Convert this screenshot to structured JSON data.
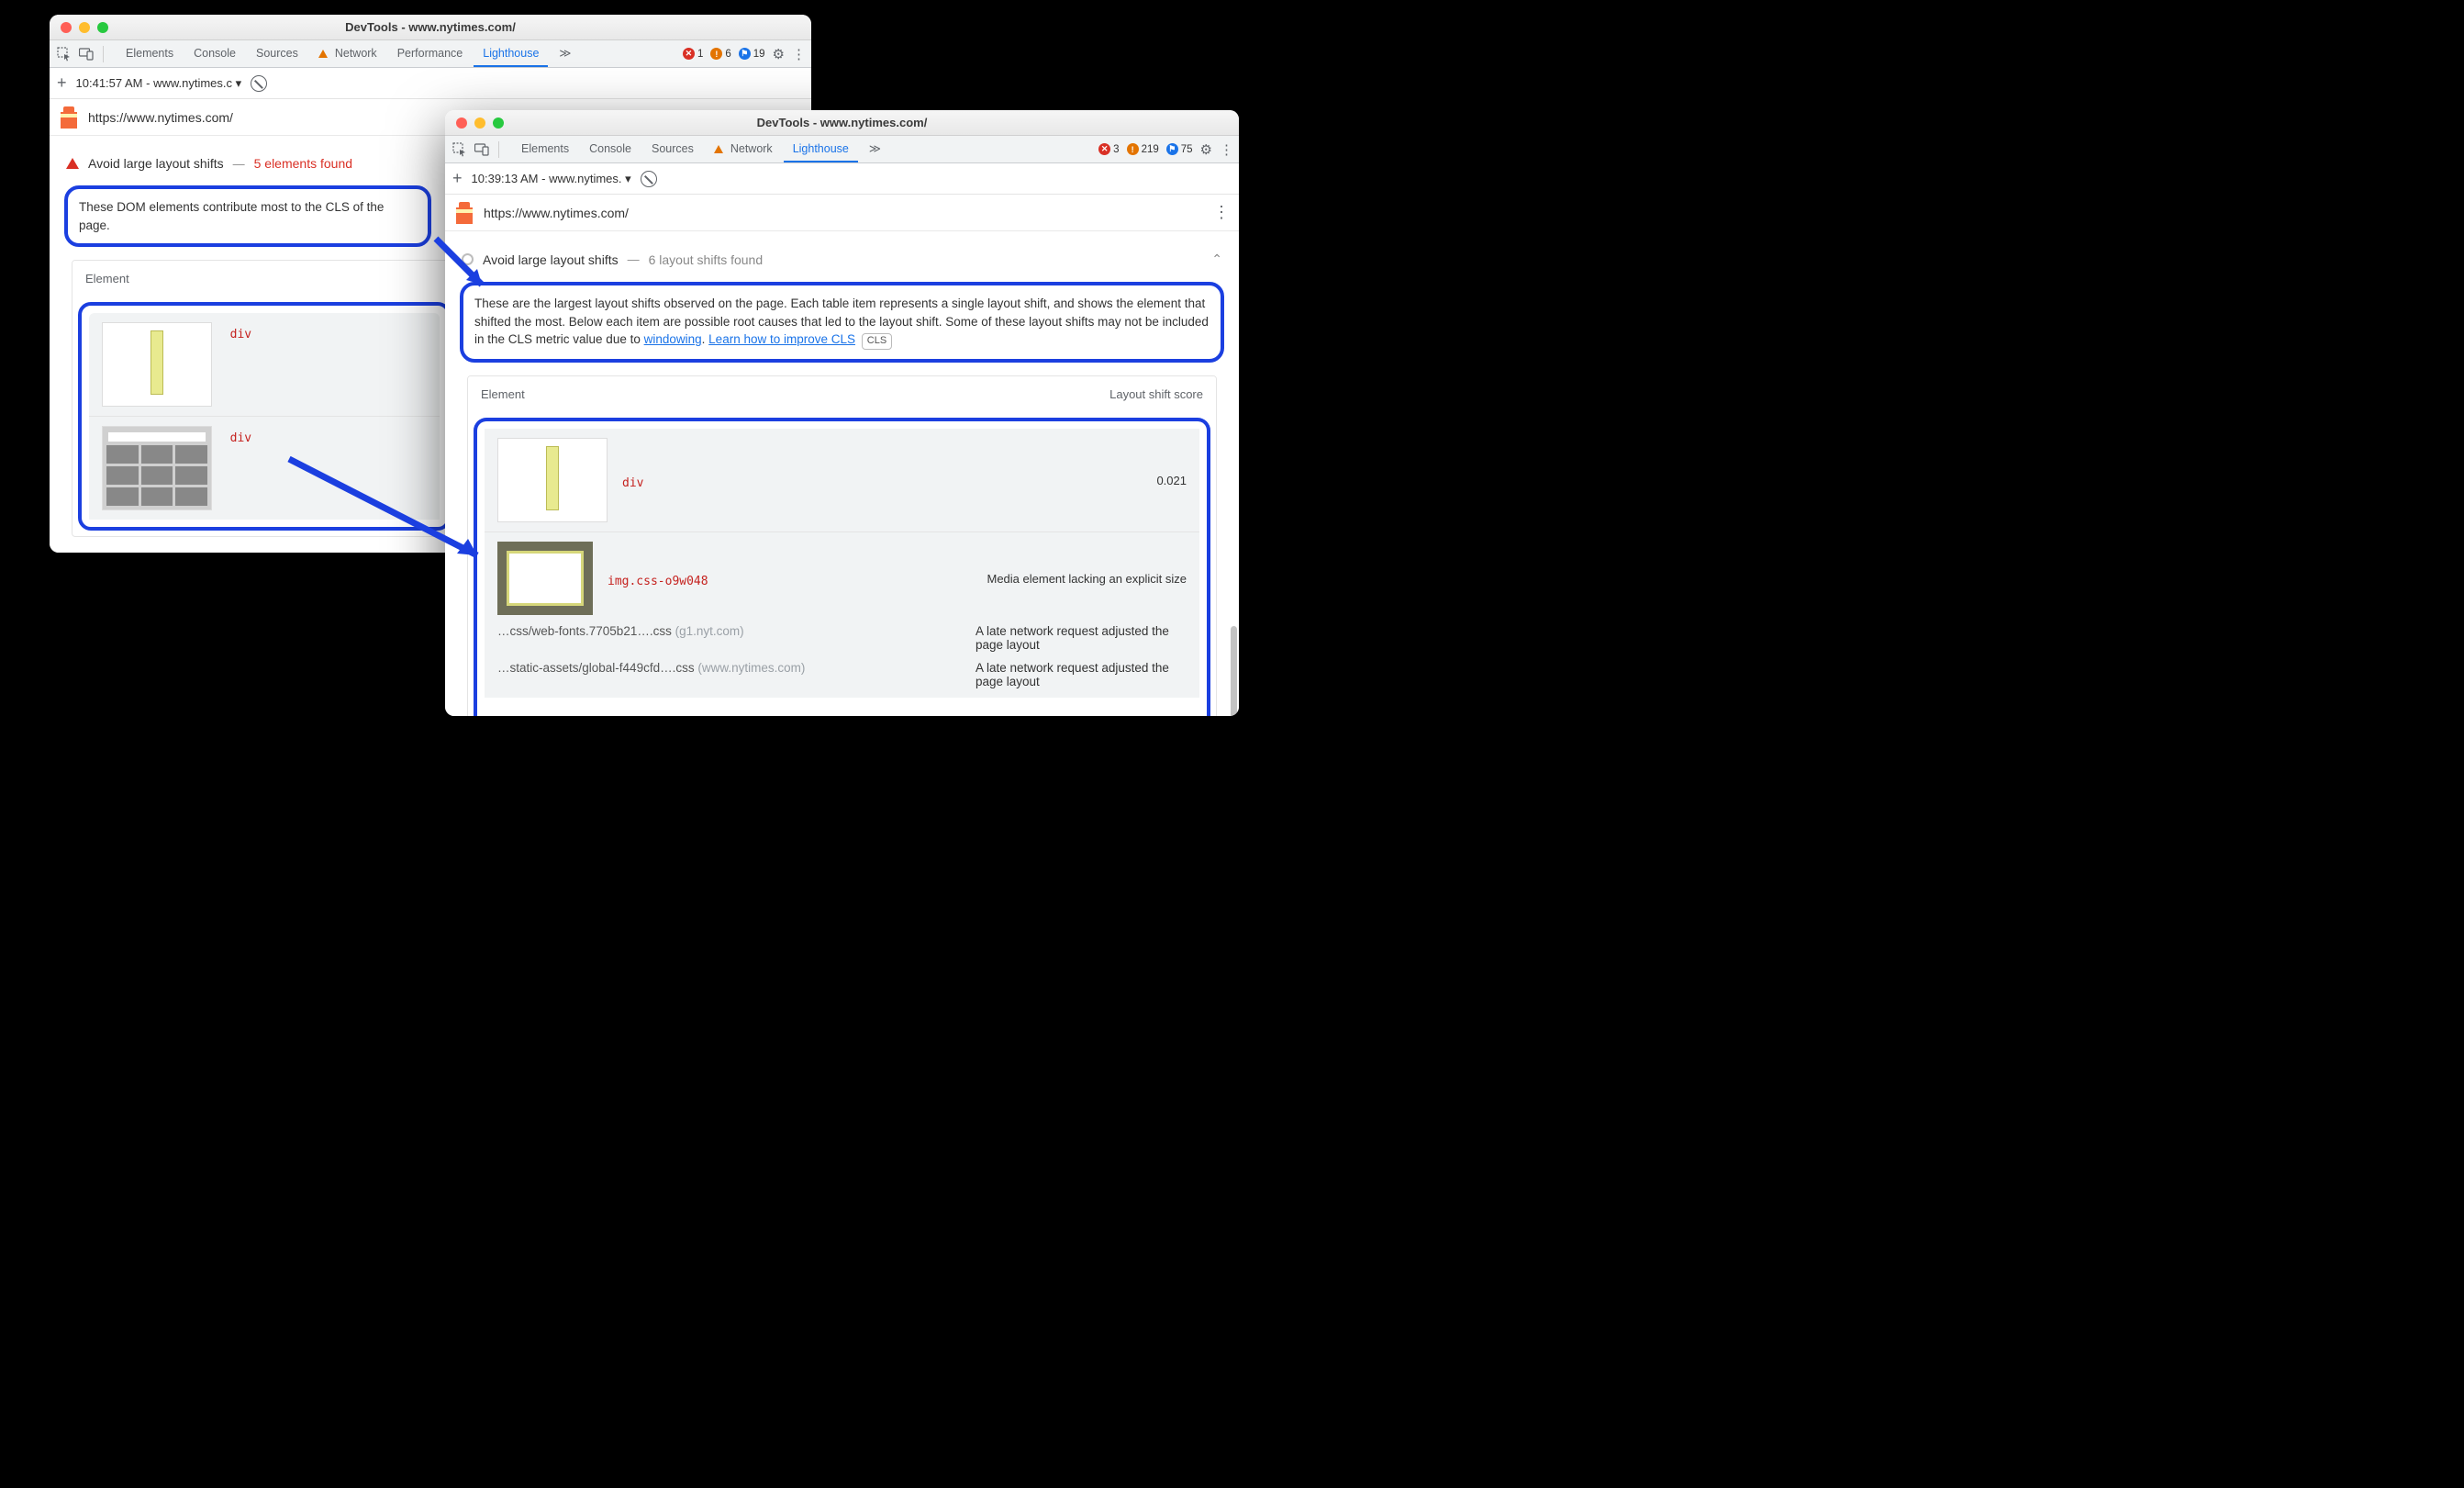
{
  "winA": {
    "title": "DevTools - www.nytimes.com/",
    "tabs": {
      "elements": "Elements",
      "console": "Console",
      "sources": "Sources",
      "network": "Network",
      "performance": "Performance",
      "lighthouse": "Lighthouse"
    },
    "badges": {
      "err": "1",
      "warn": "6",
      "blue": "19"
    },
    "sub_time": "10:41:57 AM - www.nytimes.c",
    "url": "https://www.nytimes.com/",
    "audit": {
      "title": "Avoid large layout shifts",
      "sub": "5 elements found",
      "dash": "—"
    },
    "desc": "These DOM elements contribute most to the CLS of the page.",
    "col_element": "Element",
    "rows": [
      {
        "code": "div"
      },
      {
        "code": "div"
      }
    ]
  },
  "winB": {
    "title": "DevTools - www.nytimes.com/",
    "tabs": {
      "elements": "Elements",
      "console": "Console",
      "sources": "Sources",
      "network": "Network",
      "lighthouse": "Lighthouse"
    },
    "badges": {
      "err": "3",
      "warn": "219",
      "blue": "75"
    },
    "sub_time": "10:39:13 AM - www.nytimes.",
    "url": "https://www.nytimes.com/",
    "audit": {
      "title": "Avoid large layout shifts",
      "sub": "6 layout shifts found",
      "dash": "—"
    },
    "desc_1": "These are the largest layout shifts observed on the page. Each table item represents a single layout shift, and shows the element that shifted the most. Below each item are possible root causes that led to the layout shift. Some of these layout shifts may not be included in the CLS metric value due to ",
    "desc_link1": "windowing",
    "desc_2": ". ",
    "desc_link2": "Learn how to improve CLS",
    "cls_tag": "CLS",
    "col_element": "Element",
    "col_score": "Layout shift score",
    "row1": {
      "code": "div",
      "score": "0.021"
    },
    "row2": {
      "code": "img.css-o9w048",
      "note": "Media element lacking an explicit size"
    },
    "row3": {
      "name": "…css/web-fonts.7705b21….css",
      "dom": "(g1.nyt.com)",
      "note": "A late network request adjusted the page layout"
    },
    "row4": {
      "name": "…static-assets/global-f449cfd….css",
      "dom": "(www.nytimes.com)",
      "note": "A late network request adjusted the page layout"
    }
  }
}
